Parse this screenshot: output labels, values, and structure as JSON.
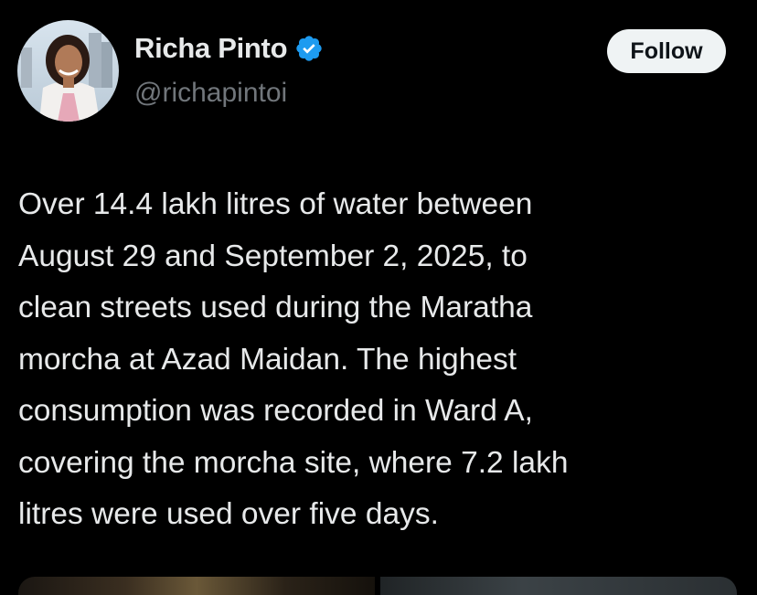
{
  "author": {
    "display_name": "Richa Pinto",
    "handle": "@richapintoi",
    "verified": true,
    "avatar_icon": "profile-photo"
  },
  "follow_button": {
    "label": "Follow"
  },
  "tweet": {
    "text": "Over 14.4 lakh litres of water between\nAugust 29 and September 2, 2025, to\nclean streets used during the Maratha\nmorcha at Azad Maidan. The highest\nconsumption was recorded in Ward A,\ncovering the morcha site, where 7.2 lakh\nlitres were used over five days."
  },
  "colors": {
    "background": "#000000",
    "primary_text": "#e7e9ea",
    "secondary_text": "#71767b",
    "verified_blue": "#1d9bf0",
    "follow_bg": "#eff3f4",
    "follow_text": "#0f1419"
  }
}
